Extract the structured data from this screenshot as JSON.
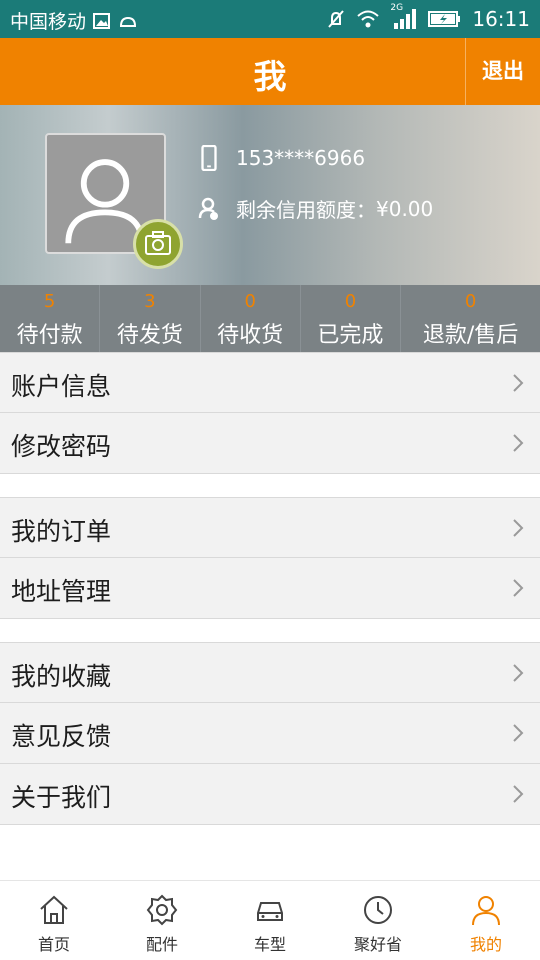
{
  "status_bar": {
    "carrier": "中国移动",
    "network": "2G",
    "time": "16:11"
  },
  "header": {
    "title": "我",
    "logout_label": "退出"
  },
  "profile": {
    "phone": "153****6966",
    "credit_label": "剩余信用额度：",
    "credit_value": "¥0.00"
  },
  "order_counters": [
    {
      "count": "5",
      "label": "待付款"
    },
    {
      "count": "3",
      "label": "待发货"
    },
    {
      "count": "0",
      "label": "待收货"
    },
    {
      "count": "0",
      "label": "已完成"
    },
    {
      "count": "0",
      "label": "退款/售后"
    }
  ],
  "menu": {
    "group1": [
      {
        "label": "账户信息"
      },
      {
        "label": "修改密码"
      }
    ],
    "group2": [
      {
        "label": "我的订单"
      },
      {
        "label": "地址管理"
      }
    ],
    "group3": [
      {
        "label": "我的收藏"
      },
      {
        "label": "意见反馈"
      },
      {
        "label": "关于我们"
      }
    ]
  },
  "bottom_nav": [
    {
      "label": "首页",
      "icon": "home-icon"
    },
    {
      "label": "配件",
      "icon": "gear-icon"
    },
    {
      "label": "车型",
      "icon": "car-icon"
    },
    {
      "label": "聚好省",
      "icon": "clock-icon"
    },
    {
      "label": "我的",
      "icon": "person-icon",
      "active": true
    }
  ],
  "colors": {
    "brand_orange": "#f08200",
    "status_bar": "#1b7b78",
    "camera_green": "#8fa430"
  }
}
